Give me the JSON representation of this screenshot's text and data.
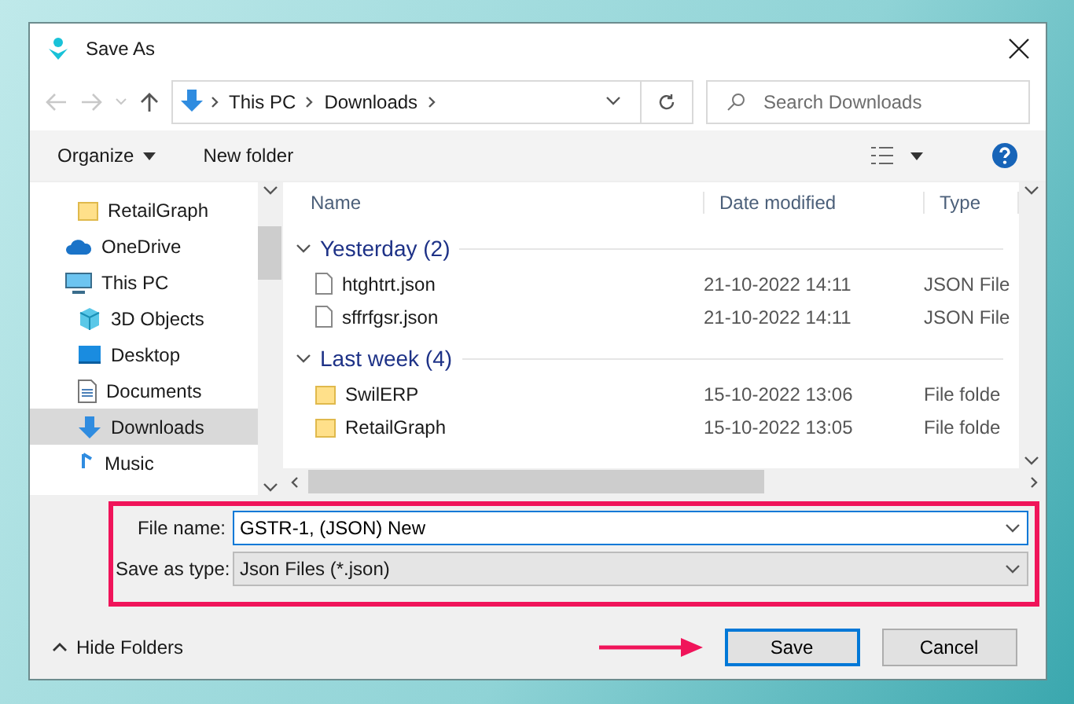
{
  "window": {
    "title": "Save As"
  },
  "address": {
    "path": [
      "This PC",
      "Downloads"
    ]
  },
  "search": {
    "placeholder": "Search Downloads"
  },
  "toolbar": {
    "organize": "Organize",
    "new_folder": "New folder"
  },
  "sidebar": {
    "items": [
      {
        "children": [
          {
            "label": "RetailGraph",
            "kind": "folder",
            "selected": false
          }
        ]
      },
      {
        "label": "OneDrive",
        "kind": "cloud",
        "selected": false
      },
      {
        "label": "This PC",
        "kind": "pc",
        "selected": false,
        "children": [
          {
            "label": "3D Objects",
            "kind": "cube",
            "selected": false
          },
          {
            "label": "Desktop",
            "kind": "desktop",
            "selected": false
          },
          {
            "label": "Documents",
            "kind": "document",
            "selected": false
          },
          {
            "label": "Downloads",
            "kind": "download",
            "selected": true
          },
          {
            "label": "Music",
            "kind": "music",
            "selected": false
          }
        ]
      }
    ]
  },
  "table": {
    "columns": [
      "Name",
      "Date modified",
      "Type"
    ],
    "groups": [
      {
        "label": "Yesterday (2)",
        "expanded": true,
        "rows": [
          {
            "name": "htghtrt.json",
            "date": "21-10-2022 14:11",
            "type": "JSON File",
            "kind": "file"
          },
          {
            "name": "sffrfgsr.json",
            "date": "21-10-2022 14:11",
            "type": "JSON File",
            "kind": "file"
          }
        ]
      },
      {
        "label": "Last week (4)",
        "expanded": true,
        "rows": [
          {
            "name": "SwilERP",
            "date": "15-10-2022 13:06",
            "type": "File folde",
            "kind": "folder"
          },
          {
            "name": "RetailGraph",
            "date": "15-10-2022 13:05",
            "type": "File folde",
            "kind": "folder"
          }
        ]
      }
    ]
  },
  "form": {
    "file_name_label": "File name:",
    "file_name": "GSTR-1, (JSON) New",
    "type_label": "Save as type:",
    "type": "Json Files (*.json)"
  },
  "footer": {
    "hide_folders": "Hide Folders",
    "save": "Save",
    "cancel": "Cancel"
  }
}
